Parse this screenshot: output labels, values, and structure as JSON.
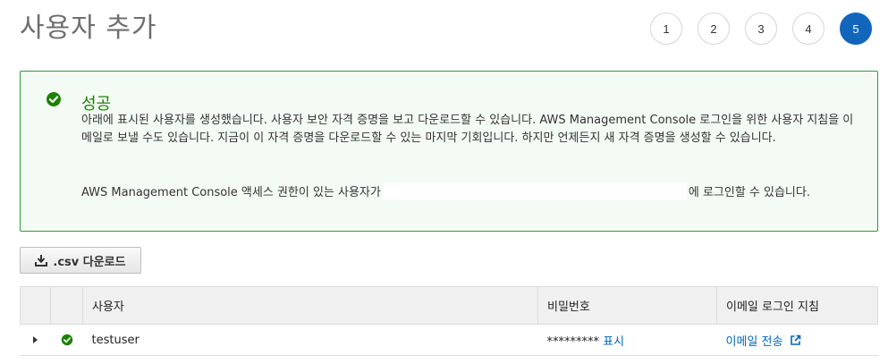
{
  "page": {
    "title": "사용자 추가"
  },
  "steps": [
    "1",
    "2",
    "3",
    "4",
    "5"
  ],
  "active_step": "5",
  "alert": {
    "title": "성공",
    "body": "아래에 표시된 사용자를 생성했습니다. 사용자 보안 자격 증명을 보고 다운로드할 수 있습니다. AWS Management Console 로그인을 위한 사용자 지침을 이메일로 보낼 수도 있습니다. 지금이 이 자격 증명을 다운로드할 수 있는 마지막 기회입니다. 하지만 언제든지 새 자격 증명을 생성할 수 있습니다.",
    "access_prefix": "AWS Management Console 액세스 권한이 있는 사용자가",
    "access_suffix": "에 로그인할 수 있습니다."
  },
  "toolbar": {
    "csv_label": ".csv 다운로드"
  },
  "table": {
    "headers": {
      "user": "사용자",
      "password": "비밀번호",
      "email": "이메일 로그인 지침"
    },
    "rows": [
      {
        "user": "testuser",
        "password_mask": "*********",
        "show_label": "표시",
        "email_label": "이메일 전송"
      }
    ]
  },
  "colors": {
    "accent": "#1166bb",
    "success": "#1d8102",
    "link": "#0066bb"
  }
}
